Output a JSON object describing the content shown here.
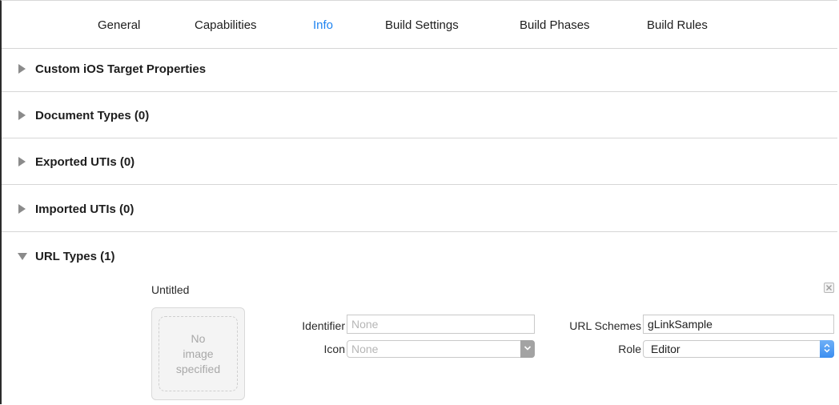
{
  "tabs": [
    {
      "label": "General",
      "active": false
    },
    {
      "label": "Capabilities",
      "active": false
    },
    {
      "label": "Info",
      "active": true
    },
    {
      "label": "Build Settings",
      "active": false
    },
    {
      "label": "Build Phases",
      "active": false
    },
    {
      "label": "Build Rules",
      "active": false
    }
  ],
  "sections": [
    {
      "title": "Custom iOS Target Properties",
      "expanded": false
    },
    {
      "title": "Document Types (0)",
      "expanded": false
    },
    {
      "title": "Exported UTIs (0)",
      "expanded": false
    },
    {
      "title": "Imported UTIs (0)",
      "expanded": false
    },
    {
      "title": "URL Types (1)",
      "expanded": true
    }
  ],
  "url_type": {
    "name": "Untitled",
    "image_well_text": [
      "No",
      "image",
      "specified"
    ],
    "identifier_label": "Identifier",
    "identifier_placeholder": "None",
    "identifier_value": "",
    "icon_label": "Icon",
    "icon_value": "None",
    "url_schemes_label": "URL Schemes",
    "url_schemes_value": "gLinkSample",
    "role_label": "Role",
    "role_value": "Editor"
  },
  "colors": {
    "accent": "#1e83f0",
    "divider": "#d6d6d6",
    "disclosure": "#8b8b8b"
  }
}
